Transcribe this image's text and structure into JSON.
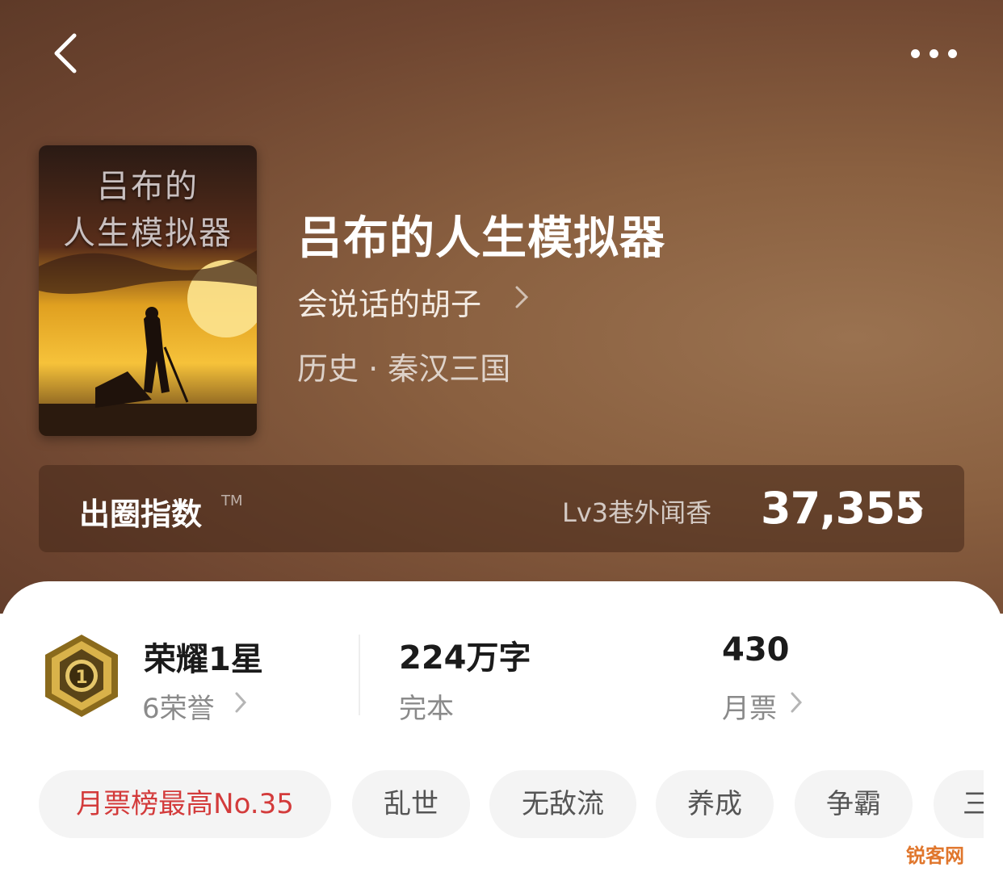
{
  "book": {
    "title": "吕布的人生模拟器",
    "author": "会说话的胡子",
    "category": "历史 · 秦汉三国",
    "cover_title_line1": "吕布的",
    "cover_title_line2": "人生模拟器"
  },
  "index": {
    "label": "出圈指数",
    "tm": "TM",
    "level": "Lv3巷外闻香",
    "value": "37,355"
  },
  "stats": {
    "honor": {
      "title": "荣耀1星",
      "sub": "6荣誉"
    },
    "words": {
      "title": "224万字",
      "sub": "完本"
    },
    "votes": {
      "title": "430",
      "sub": "月票"
    }
  },
  "tags": [
    "月票榜最高No.35",
    "乱世",
    "无敌流",
    "养成",
    "争霸",
    "三"
  ],
  "watermark": "锐客网",
  "colors": {
    "hero_bg": "#7a5034",
    "hot_tag": "#d33b3b",
    "badge_gold": "#c9a23a"
  }
}
